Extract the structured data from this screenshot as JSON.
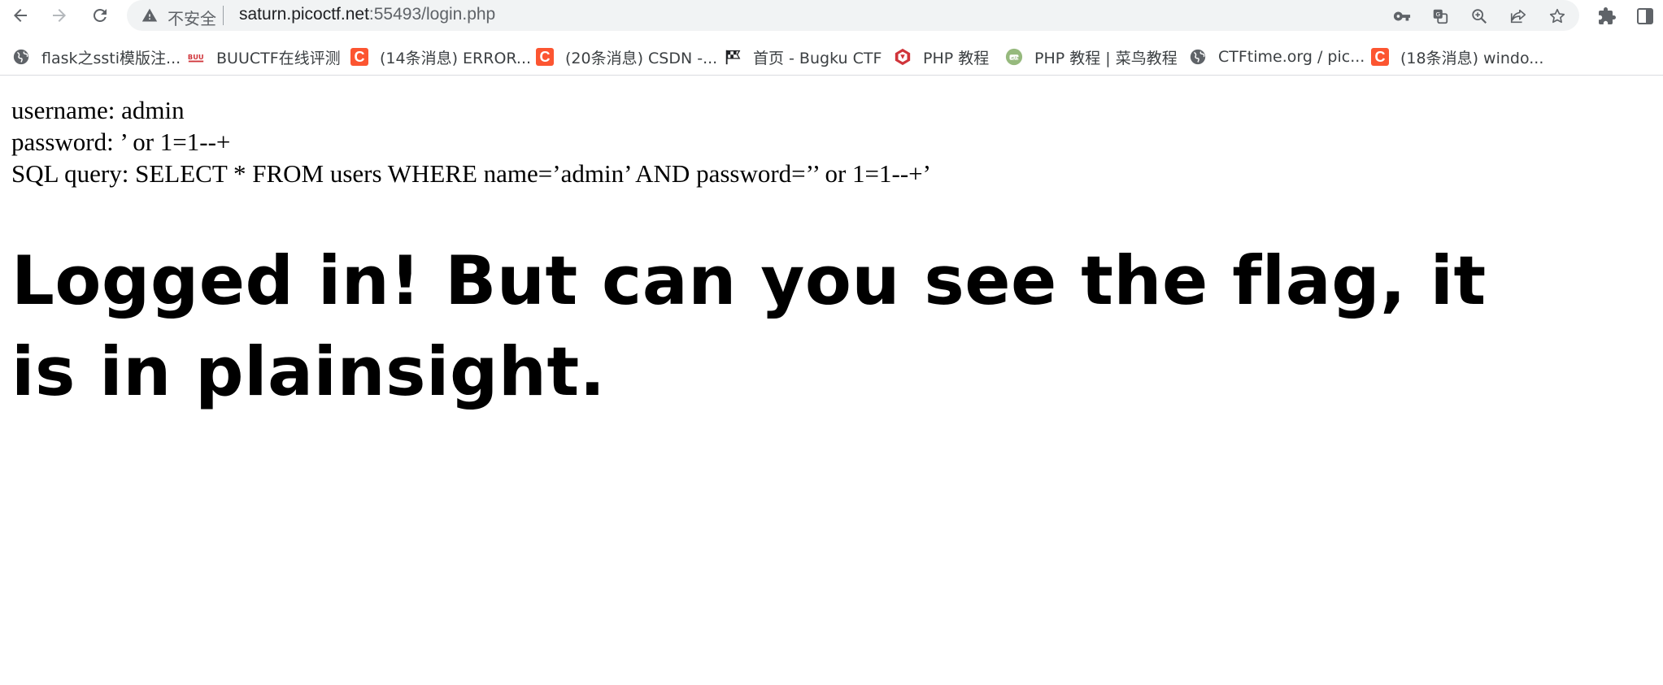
{
  "browser": {
    "security_label": "不安全",
    "url_host": "saturn.picoctf.net",
    "url_rest": ":55493/login.php"
  },
  "bookmarks": [
    {
      "label": "flask之ssti模版注...",
      "icon": "globe-icon"
    },
    {
      "label": "BUUCTF在线评测",
      "icon": "buuctf-icon"
    },
    {
      "label": "(14条消息) ERROR...",
      "icon": "csdn-icon"
    },
    {
      "label": "(20条消息) CSDN -...",
      "icon": "csdn-icon"
    },
    {
      "label": "首页 - Bugku CTF",
      "icon": "checkered-flag-icon"
    },
    {
      "label": "PHP 教程",
      "icon": "w3c-icon"
    },
    {
      "label": "PHP 教程 | 菜鸟教程",
      "icon": "runoob-icon"
    },
    {
      "label": "CTFtime.org / pic...",
      "icon": "globe-icon"
    },
    {
      "label": "(18条消息) windo...",
      "icon": "csdn-icon"
    }
  ],
  "page": {
    "username_line": "username: admin",
    "password_line": "password: ’ or 1=1--+",
    "query_line": "SQL query: SELECT * FROM users WHERE name=’admin’ AND password=’’ or 1=1--+’",
    "headline": "Logged in! But can you see the flag, it is in plainsight."
  },
  "colors": {
    "omnibox_bg": "#f1f3f4",
    "csdn_red": "#fc5531",
    "text": "#000000"
  }
}
